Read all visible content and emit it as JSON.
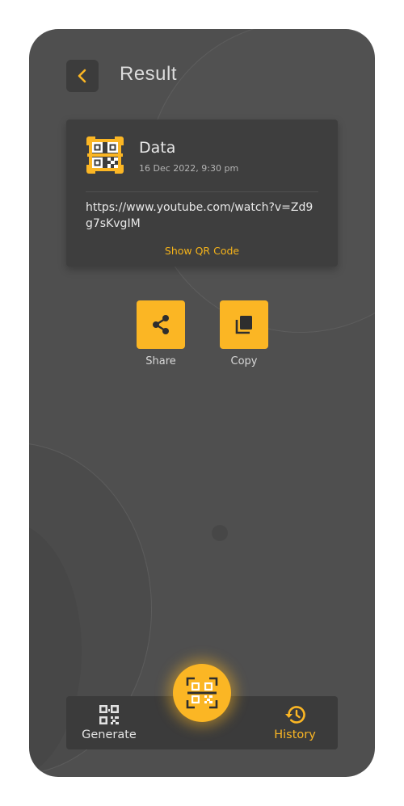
{
  "header": {
    "title": "Result"
  },
  "result": {
    "type": "Data",
    "date": "16 Dec 2022, 9:30 pm",
    "url": "https://www.youtube.com/watch?v=Zd9g7sKvgIM",
    "show_qr_label": "Show QR Code"
  },
  "actions": {
    "share_label": "Share",
    "copy_label": "Copy"
  },
  "bottom_nav": {
    "generate_label": "Generate",
    "history_label": "History"
  },
  "icons": {
    "back": "chevron-left-icon",
    "result_type": "qr-scan-icon",
    "share": "share-icon",
    "copy": "copy-icon",
    "generate": "qr-code-icon",
    "scan": "qr-scan-icon",
    "history": "history-icon"
  },
  "colors": {
    "accent": "#fbb624",
    "background": "#4f4f4f",
    "card": "#3e3e3e",
    "bar": "#3b3b3b"
  }
}
